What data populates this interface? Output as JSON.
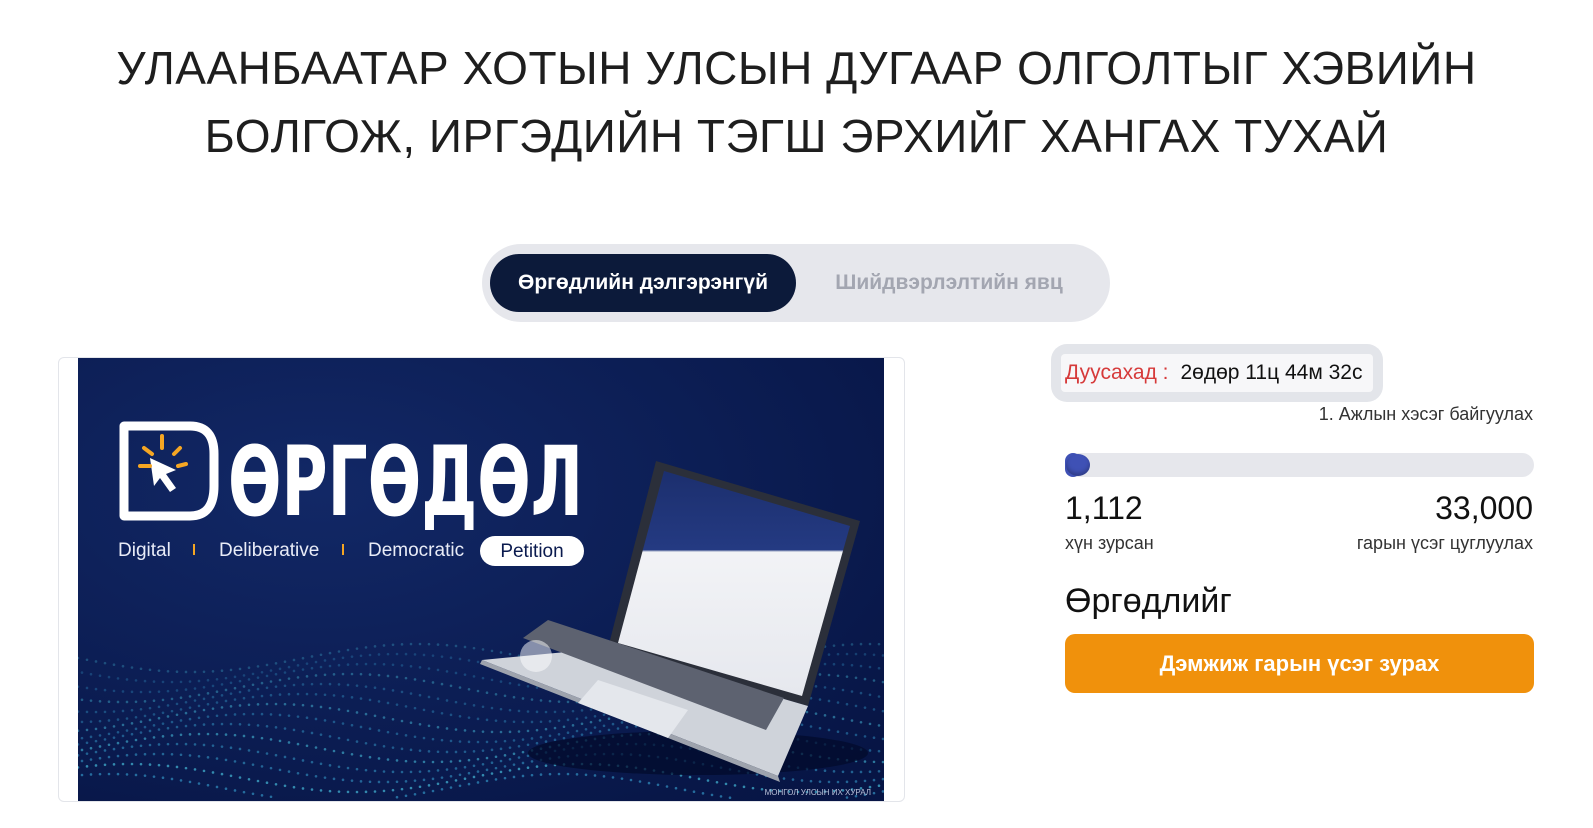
{
  "page": {
    "title_line1": "УЛААНБААТАР ХОТЫН УЛСЫН ДУГААР ОЛГОЛТЫГ ХЭВИЙН",
    "title_line2": "БОЛГОЖ, ИРГЭДИЙН ТЭГШ ЭРХИЙГ ХАНГАХ ТУХАЙ"
  },
  "tabs": [
    {
      "label": "Өргөдлийн дэлгэрэнгүй",
      "active": true
    },
    {
      "label": "Шийдвэрлэлтийн явц",
      "active": false
    }
  ],
  "banner": {
    "logo_text": "ӨРГӨДӨЛ",
    "tag1": "Digital",
    "tag2": "Deliberative",
    "tag3": "Democratic",
    "tag4": "Petition",
    "footer": "МОНГОЛ УЛСЫН ИХ ХУРАЛ",
    "bg_color": "#0a1a4e",
    "icon": "cursor-click-icon"
  },
  "timer": {
    "label": "Дуусахад :",
    "value": "2өдөр 11ц 44м 32с"
  },
  "stage": "1. Ажлын хэсэг байгуулах",
  "progress": {
    "signed": "1,112",
    "signed_label": "хүн зурсан",
    "goal": "33,000",
    "goal_label": "гарын үсэг цуглуулах",
    "fraction": 0.0337,
    "color": "#3f51b5"
  },
  "petition": {
    "section_title": "Өргөдлийг",
    "sign_button": "Дэмжиж гарын үсэг зурах",
    "button_color": "#f0910c"
  }
}
